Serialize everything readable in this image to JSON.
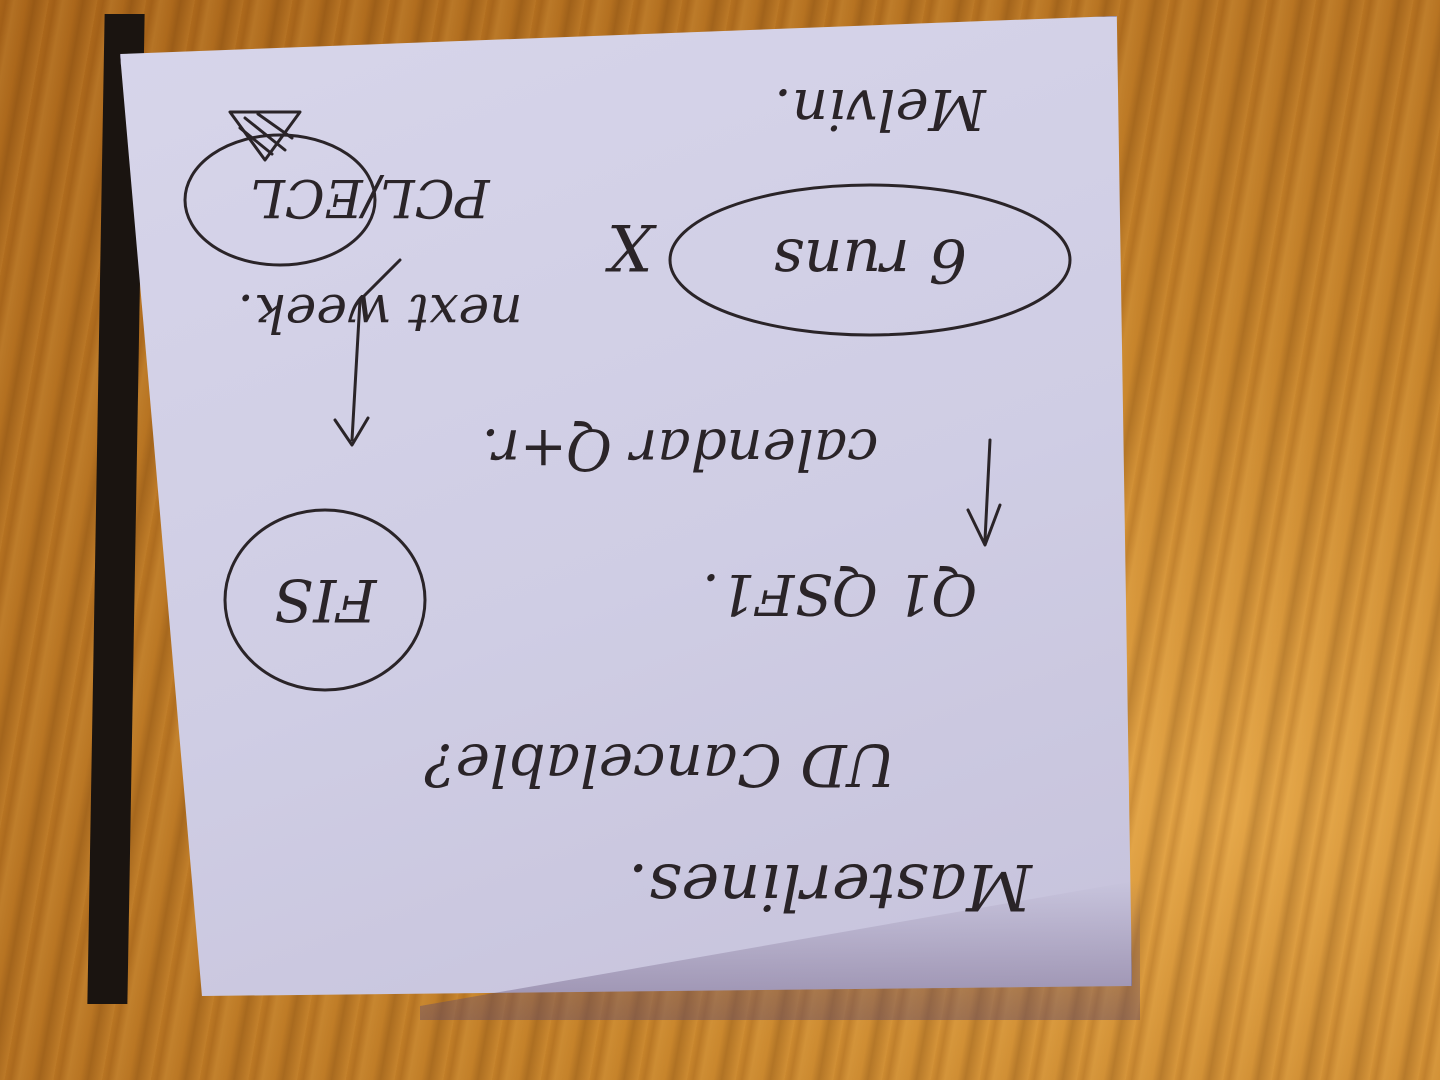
{
  "note": {
    "lines": {
      "line1": "Masterlines.",
      "line2": "UD Cancelable?",
      "line3": "Q1 QSF1.",
      "line4": "calendar Q+r.",
      "line5": "6 runs",
      "line6": "X",
      "line7": "Melvin.",
      "circled_fis": "FIS",
      "circled_pcl": "PCL/ECL",
      "next_week": "next week."
    },
    "icons": {
      "arrow_down_1": "arrow-icon",
      "arrow_down_2": "arrow-icon",
      "doodle": "hatched-triangle-icon"
    }
  },
  "colors": {
    "note": "#d3d1e7",
    "ink": "#2a2428",
    "table": "#c7842b"
  }
}
